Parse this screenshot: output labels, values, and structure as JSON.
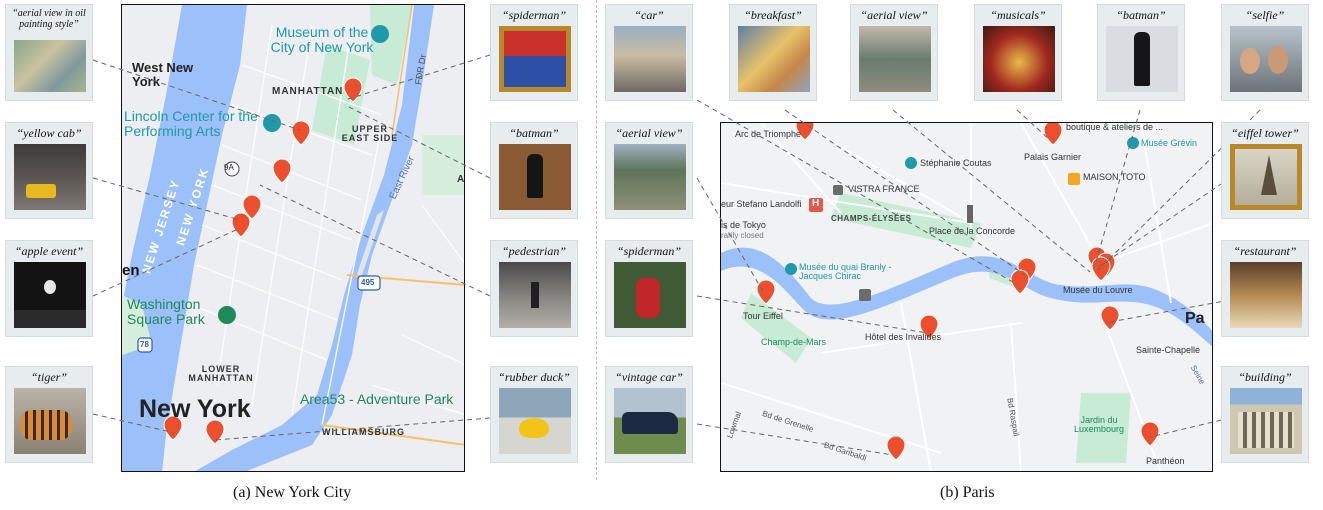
{
  "nyc": {
    "caption": "(a) New York City",
    "thumbnails": [
      {
        "label": "“aerial view in oil painting style”",
        "icon": "painting-thumbnail"
      },
      {
        "label": "“yellow cab”",
        "icon": "photo-thumbnail"
      },
      {
        "label": "“apple event”",
        "icon": "photo-thumbnail"
      },
      {
        "label": "“tiger”",
        "icon": "photo-thumbnail"
      },
      {
        "label": "“spiderman”",
        "icon": "painting-thumbnail"
      },
      {
        "label": "“batman”",
        "icon": "painting-thumbnail"
      },
      {
        "label": "“pedestrian”",
        "icon": "photo-thumbnail"
      },
      {
        "label": "“rubber duck”",
        "icon": "photo-thumbnail"
      }
    ],
    "map_labels": {
      "museum": "Museum of the City of New York",
      "west_new_york": "West New York",
      "manhattan": "MANHATTAN",
      "lincoln": "Lincoln Center for the Performing Arts",
      "upper_east": "UPPER EAST SIDE",
      "new_jersey": "NEW JERSEY",
      "new_york_state": "NEW YORK",
      "fdr": "FDR Dr",
      "east_river": "East River",
      "route_9a": "9A",
      "route_495": "495",
      "route_78": "78",
      "en": "en",
      "washington": "Washington Square Park",
      "lower_manhattan": "LOWER MANHATTAN",
      "new_york": "New York",
      "area53": "Area53 - Adventure Park",
      "williamsburg": "WILLIAMSBURG",
      "a_edge": "A"
    }
  },
  "paris": {
    "caption": "(b) Paris",
    "thumbnails": [
      {
        "label": "“car”",
        "icon": "photo-thumbnail"
      },
      {
        "label": "“breakfast”",
        "icon": "painting-thumbnail"
      },
      {
        "label": "“aerial view”",
        "icon": "photo-thumbnail"
      },
      {
        "label": "“musicals”",
        "icon": "photo-thumbnail"
      },
      {
        "label": "“batman”",
        "icon": "photo-thumbnail"
      },
      {
        "label": "“selfie”",
        "icon": "photo-thumbnail"
      },
      {
        "label": "“aerial view”",
        "icon": "photo-thumbnail"
      },
      {
        "label": "“spiderman”",
        "icon": "photo-thumbnail"
      },
      {
        "label": "“vintage car”",
        "icon": "photo-thumbnail"
      },
      {
        "label": "“eiffel tower”",
        "icon": "painting-thumbnail"
      },
      {
        "label": "“restaurant”",
        "icon": "photo-thumbnail"
      },
      {
        "label": "“building”",
        "icon": "photo-thumbnail"
      }
    ],
    "map_labels": {
      "arc": "Arc de Triomphe",
      "boutique": "boutique & ateliers de ...",
      "palais": "Palais Garnier",
      "musee_grevin": "Musée Grévin",
      "stephanie": "Stéphanie Coutas",
      "vistra": "VISTRA FRANCE",
      "maison": "MAISON TOTO",
      "landolfi": "eur Stefano Landolfi",
      "hotel_icon": "H",
      "champs": "CHAMPS-ÉLYSÉES",
      "tokyo": "is de Tokyo",
      "tokyo_closed": "rarily closed",
      "concorde": "Place de la Concorde",
      "branly": "Musée du quai Branly - Jacques Chirac",
      "louvre": "Musée du Louvre",
      "pa": "Pa",
      "tour": "Tour Eiffel",
      "invalides": "Hôtel des Invalides",
      "chapelle": "Sainte-Chapelle",
      "champ_mars": "Champ-de-Mars",
      "grenelle": "Bd de Grenelle",
      "garibaldi": "Bd Garibaldi",
      "raspail": "Bd Raspail",
      "jardin": "Jardin du Luxembourg",
      "pantheon": "Panthéon",
      "lowmal": "Lowmal",
      "seine_edge": "Seine"
    }
  },
  "colors": {
    "water": "#9cc0f9",
    "park": "#c7ebd4",
    "pin": "#ec4f2d",
    "poi_teal": "#1e9aa8",
    "park_label": "#1e8a5a",
    "leader": "#666666"
  }
}
